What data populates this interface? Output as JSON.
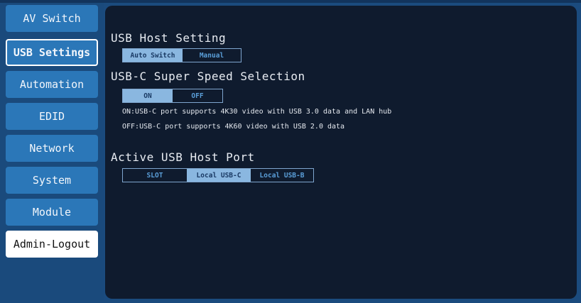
{
  "sidebar": {
    "items": [
      {
        "label": "AV Switch"
      },
      {
        "label": "USB Settings"
      },
      {
        "label": "Automation"
      },
      {
        "label": "EDID"
      },
      {
        "label": "Network"
      },
      {
        "label": "System"
      },
      {
        "label": "Module"
      },
      {
        "label": "Admin-Logout"
      }
    ],
    "active": "USB Settings"
  },
  "usb_host_setting": {
    "title": "USB Host Setting",
    "options": [
      "Auto Switch",
      "Manual"
    ],
    "selected": "Auto Switch"
  },
  "usbc_speed": {
    "title": "USB-C Super Speed Selection",
    "options": [
      "ON",
      "OFF"
    ],
    "selected": "ON",
    "notes": [
      "ON:USB-C port supports 4K30 video with USB 3.0 data and LAN hub",
      "OFF:USB-C port supports 4K60 video with USB 2.0 data"
    ]
  },
  "active_host_port": {
    "title": "Active USB Host Port",
    "options": [
      "SLOT",
      "Local USB-C",
      "Local USB-B"
    ],
    "selected": "Local USB-C"
  },
  "colors": {
    "nav_button": "#2b77b8",
    "panel_bg": "#0f1b2e",
    "frame_bg": "#1b4b7e",
    "segment_on": "#8ab7e0",
    "segment_text": "#5a9ed8"
  }
}
